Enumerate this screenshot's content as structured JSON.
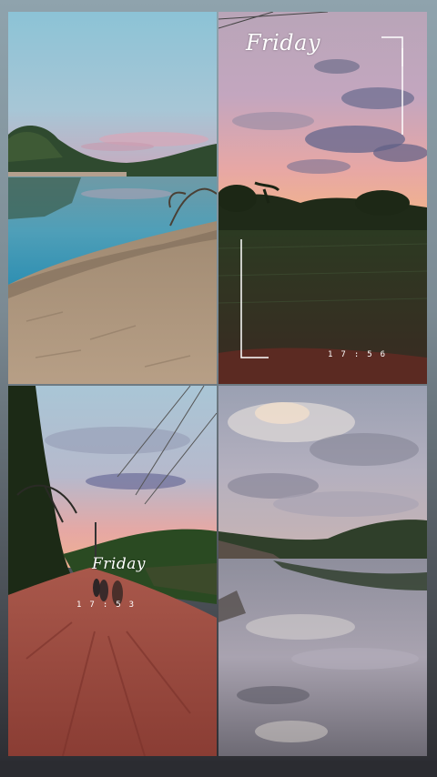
{
  "story": {
    "photos": [
      {
        "scene": "river-dusk-bank"
      },
      {
        "scene": "pink-cloud-sky-field",
        "script_text": "Friday",
        "time_text": "17:56"
      },
      {
        "scene": "red-dirt-road",
        "script_text": "Friday",
        "time_text": "17:53"
      },
      {
        "scene": "cloud-reflection-river"
      }
    ]
  }
}
